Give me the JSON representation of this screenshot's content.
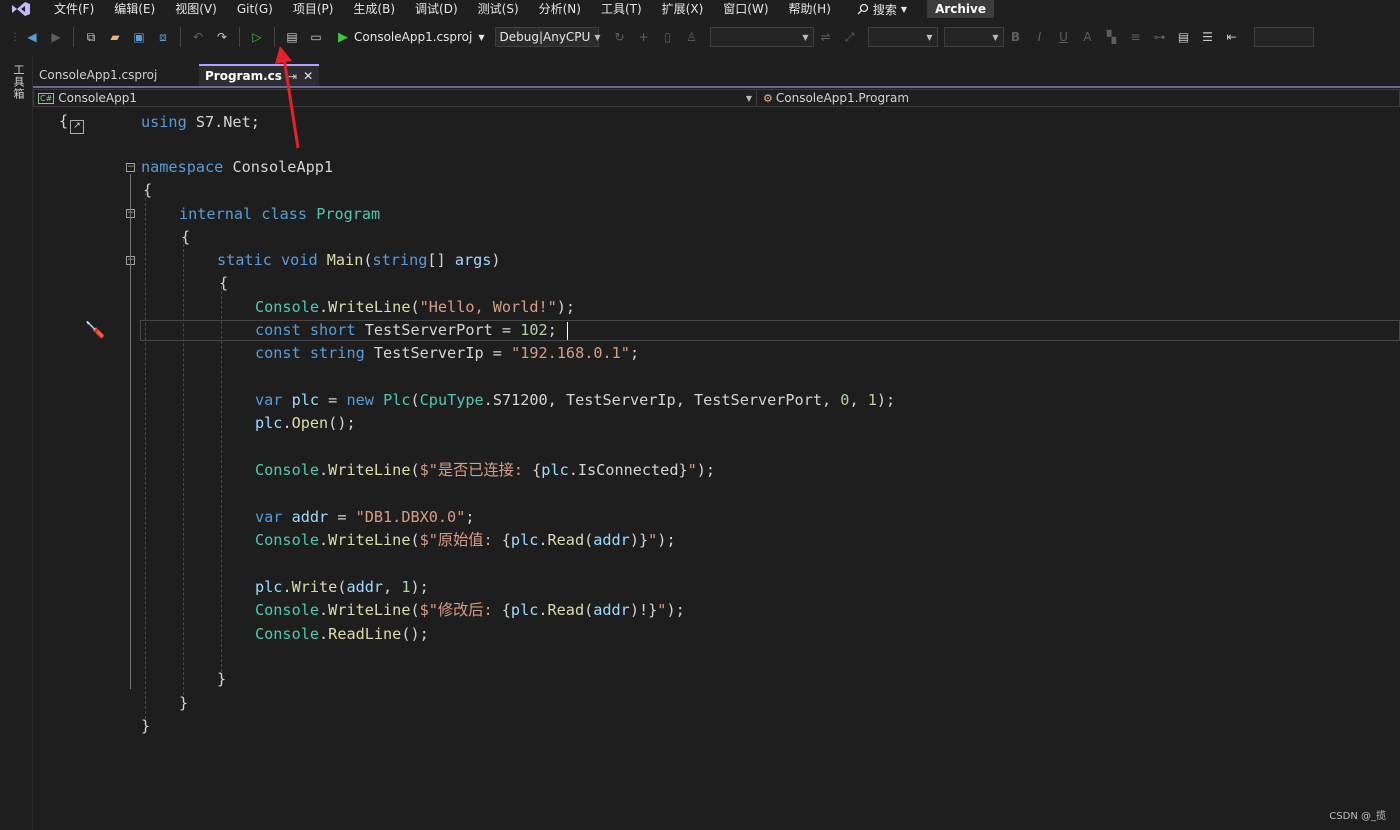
{
  "menu": {
    "items": [
      "文件(F)",
      "编辑(E)",
      "视图(V)",
      "Git(G)",
      "项目(P)",
      "生成(B)",
      "调试(D)",
      "测试(S)",
      "分析(N)",
      "工具(T)",
      "扩展(X)",
      "窗口(W)",
      "帮助(H)"
    ],
    "search_label": "搜索",
    "archive_label": "Archive"
  },
  "toolbar": {
    "start_label": "ConsoleApp1.csproj",
    "config_label": "Debug|AnyCPU"
  },
  "side": {
    "toolbox_label": "工具箱"
  },
  "tabs": [
    {
      "label": "ConsoleApp1.csproj"
    },
    {
      "label": "Program.cs"
    }
  ],
  "nav": {
    "project": "ConsoleApp1",
    "member": "ConsoleApp1.Program"
  },
  "code": {
    "l1": [
      "using",
      " S7.Net;"
    ],
    "l2": [
      "namespace",
      " ConsoleApp1"
    ],
    "l3": "{",
    "l4": [
      "internal",
      " ",
      "class",
      " ",
      "Program"
    ],
    "l5": "{",
    "l6": [
      "static",
      " ",
      "void",
      " ",
      "Main",
      "(",
      "string",
      "[] ",
      "args",
      ")"
    ],
    "l7": "{",
    "l8": [
      "Console",
      ".",
      "WriteLine",
      "(",
      "\"Hello, World!\"",
      ");"
    ],
    "l9": [
      "const",
      " ",
      "short",
      " TestServerPort = ",
      "102",
      ";"
    ],
    "l10": [
      "const",
      " ",
      "string",
      " TestServerIp = ",
      "\"192.168.0.1\"",
      ";"
    ],
    "l11": [
      "var",
      " ",
      "plc",
      " = ",
      "new",
      " ",
      "Plc",
      "(",
      "CpuType",
      ".S71200, TestServerIp, TestServerPort, ",
      "0",
      ", ",
      "1",
      ");"
    ],
    "l12": [
      "plc",
      ".",
      "Open",
      "();"
    ],
    "l13": [
      "Console",
      ".",
      "WriteLine",
      "(",
      "$\"是否已连接: ",
      "{",
      "plc",
      ".IsConnected",
      "}",
      "\"",
      ");"
    ],
    "l14": [
      "var",
      " ",
      "addr",
      " = ",
      "\"DB1.DBX0.0\"",
      ";"
    ],
    "l15": [
      "Console",
      ".",
      "WriteLine",
      "(",
      "$\"原始值: ",
      "{",
      "plc",
      ".",
      "Read",
      "(",
      "addr",
      ")",
      "}",
      "\"",
      ");"
    ],
    "l16": [
      "plc",
      ".",
      "Write",
      "(",
      "addr",
      ", ",
      "1",
      ");"
    ],
    "l17": [
      "Console",
      ".",
      "WriteLine",
      "(",
      "$\"修改后: ",
      "{",
      "plc",
      ".",
      "Read",
      "(",
      "addr",
      ")!",
      "}",
      "\"",
      ");"
    ],
    "l18": [
      "Console",
      ".",
      "ReadLine",
      "();"
    ],
    "l19": "}",
    "l20": "}",
    "l21": "}"
  },
  "watermark": "CSDN @_揽",
  "colors": {
    "keyword": "#569cd6",
    "type": "#4ec9b0",
    "method": "#dcdcaa",
    "string": "#d69d85",
    "number": "#b5cea8",
    "accent": "#b1a1ff",
    "arrow": "#e8202a"
  }
}
